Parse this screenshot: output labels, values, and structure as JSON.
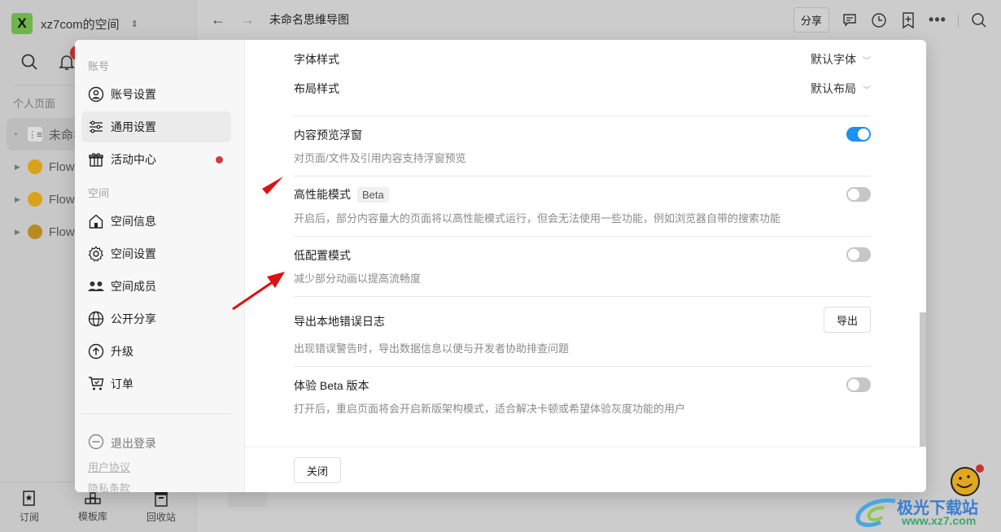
{
  "app": {
    "workspace_logo": "X",
    "workspace_name": "xz7com的空间",
    "notification_count": "1",
    "personal_section": "个人页面",
    "pages": [
      {
        "label": "未命名思维导图",
        "icon": "mindmap-icon",
        "active": true
      },
      {
        "label": "FlowUs",
        "icon": "bee-icon"
      },
      {
        "label": "FlowUs",
        "icon": "bee-icon"
      },
      {
        "label": "FlowUs",
        "icon": "bee-icon"
      }
    ],
    "bottom_bar": [
      {
        "label": "订阅",
        "icon": "subscribe-icon"
      },
      {
        "label": "模板库",
        "icon": "template-icon"
      },
      {
        "label": "回收站",
        "icon": "trash-icon"
      }
    ]
  },
  "topbar": {
    "title": "未命名思维导图",
    "share_label": "分享"
  },
  "settings_modal": {
    "nav": {
      "account_section": "账号",
      "space_section": "空间",
      "items": [
        {
          "label": "账号设置",
          "icon": "user-circle-icon"
        },
        {
          "label": "通用设置",
          "icon": "sliders-icon",
          "active": true
        },
        {
          "label": "活动中心",
          "icon": "gift-icon",
          "dot": true
        },
        {
          "label": "空间信息",
          "icon": "home-icon"
        },
        {
          "label": "空间设置",
          "icon": "gear-icon"
        },
        {
          "label": "空间成员",
          "icon": "members-icon"
        },
        {
          "label": "公开分享",
          "icon": "globe-icon"
        },
        {
          "label": "升级",
          "icon": "upgrade-icon"
        },
        {
          "label": "订单",
          "icon": "cart-icon"
        }
      ],
      "logout_label": "退出登录",
      "user_agreement": "用户协议",
      "privacy_terms": "隐私条款"
    },
    "content": {
      "font_style": {
        "label": "字体样式",
        "value": "默认字体"
      },
      "layout_style": {
        "label": "布局样式",
        "value": "默认布局"
      },
      "settings": [
        {
          "title": "内容预览浮窗",
          "desc": "对页面/文件及引用内容支持浮窗预览",
          "control": "toggle",
          "on": true
        },
        {
          "title": "高性能模式",
          "tag": "Beta",
          "desc": "开启后，部分内容量大的页面将以高性能模式运行，但会无法使用一些功能，例如浏览器自带的搜索功能",
          "control": "toggle",
          "on": false
        },
        {
          "title": "低配置模式",
          "desc": "减少部分动画以提高流畅度",
          "control": "toggle",
          "on": false
        },
        {
          "title": "导出本地错误日志",
          "desc": "出现错误警告时，导出数据信息以便与开发者协助排查问题",
          "control": "button",
          "button_label": "导出"
        },
        {
          "title": "体验 Beta 版本",
          "desc": "打开后，重启页面将会开启新版架构模式，适合解决卡顿或希望体验灰度功能的用户",
          "control": "toggle",
          "on": false
        }
      ]
    },
    "footer": {
      "close_label": "关闭"
    }
  },
  "watermark": {
    "text": "极光下载站",
    "url": "www.xz7.com"
  },
  "colors": {
    "accent": "#1e90f0",
    "danger": "#d0393e",
    "annotation_arrow": "#e01010"
  }
}
